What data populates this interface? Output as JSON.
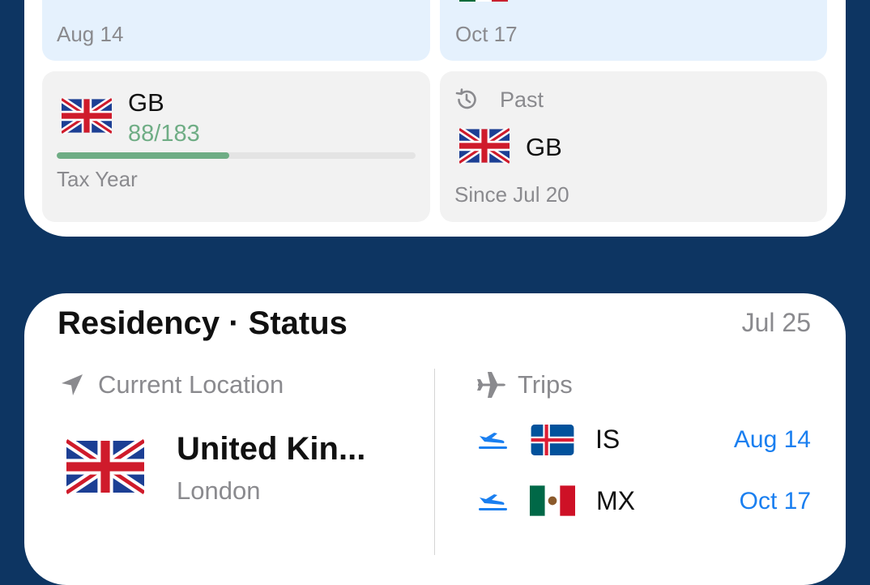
{
  "top_widget": {
    "upcoming_left": {
      "date": "Aug 14"
    },
    "upcoming_right": {
      "date": "Oct 17"
    },
    "tax_tile": {
      "country": "GB",
      "count": "88/183",
      "progress": 0.481,
      "label": "Tax Year"
    },
    "past_tile": {
      "heading": "Past",
      "country": "GB",
      "since": "Since Jul 20"
    }
  },
  "status_widget": {
    "title": "Residency · Status",
    "date": "Jul 25",
    "current_location": {
      "heading": "Current Location",
      "country": "United Kin...",
      "city": "London"
    },
    "trips": {
      "heading": "Trips",
      "items": [
        {
          "code": "IS",
          "date": "Aug 14",
          "flag": "iceland"
        },
        {
          "code": "MX",
          "date": "Oct 17",
          "flag": "mexico"
        }
      ]
    }
  },
  "colors": {
    "background": "#0d3562",
    "accent_blue": "#1a7ff0",
    "tile_blue": "#e5f1fd",
    "tile_gray": "#f2f2f2",
    "progress_green": "#6fad85"
  },
  "icons": [
    "history-icon",
    "location-arrow-icon",
    "airplane-icon",
    "plane-departure-icon"
  ]
}
